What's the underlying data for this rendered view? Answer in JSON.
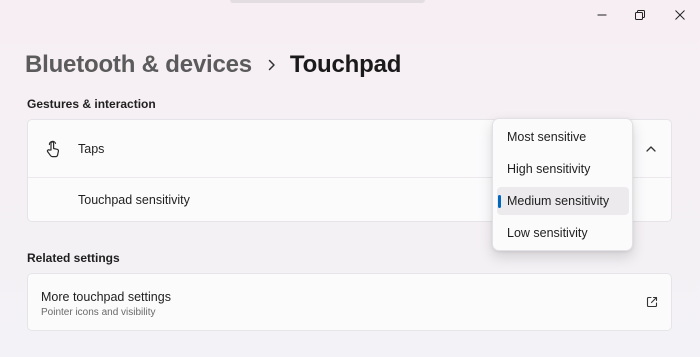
{
  "colors": {
    "accent": "#0067c0"
  },
  "window_controls": [
    {
      "name": "minimize-icon"
    },
    {
      "name": "maximize-icon"
    },
    {
      "name": "close-icon"
    }
  ],
  "breadcrumb": {
    "parent": "Bluetooth & devices",
    "separator_icon": "chevron-right-icon",
    "current": "Touchpad"
  },
  "gestures_section": {
    "title": "Gestures & interaction",
    "taps": {
      "icon": "hand-tap-icon",
      "label": "Taps",
      "expanded": true,
      "expand_icon": "chevron-up-icon"
    },
    "sensitivity": {
      "label": "Touchpad sensitivity",
      "selected": "Medium sensitivity",
      "options": [
        "Most sensitive",
        "High sensitivity",
        "Medium sensitivity",
        "Low sensitivity"
      ]
    }
  },
  "related_section": {
    "title": "Related settings",
    "more": {
      "title": "More touchpad settings",
      "subtitle": "Pointer icons and visibility",
      "icon": "open-external-icon"
    }
  }
}
